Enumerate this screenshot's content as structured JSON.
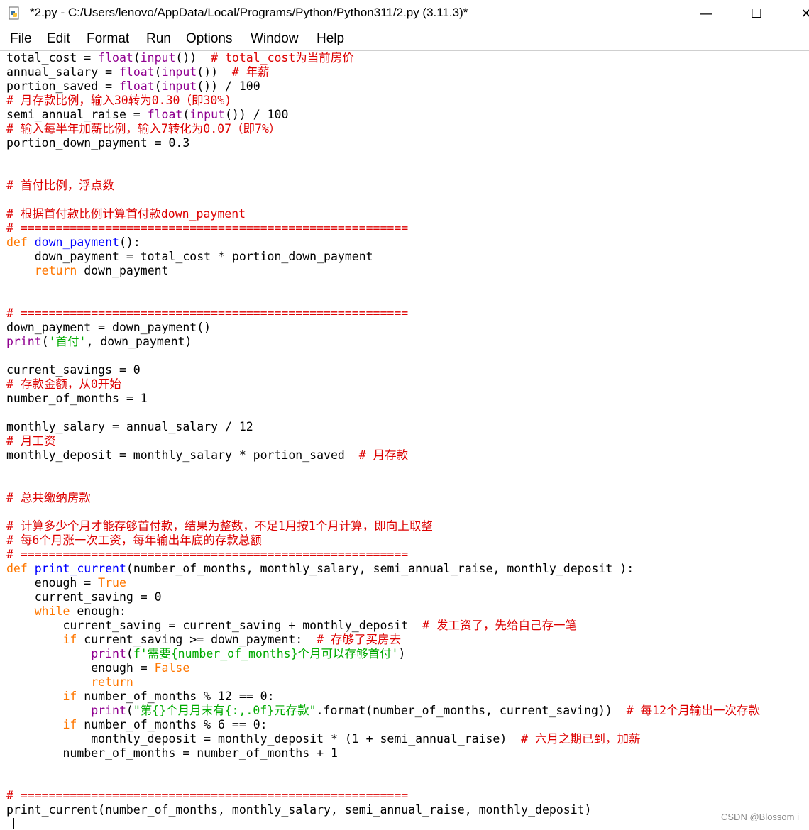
{
  "window": {
    "title": "*2.py - C:/Users/lenovo/AppData/Local/Programs/Python/Python311/2.py (3.11.3)*",
    "icon": "python-file-icon",
    "controls": {
      "minimize": "—",
      "maximize": "☐",
      "close": "✕"
    }
  },
  "menu": [
    "File",
    "Edit",
    "Format",
    "Run",
    "Options",
    "Window",
    "Help"
  ],
  "syntax_colors": {
    "comment": "#dd0000",
    "keyword": "#ff7700",
    "builtin": "#900090",
    "definition": "#0000ff",
    "string": "#00aa00"
  },
  "code_lines": [
    [
      [
        "total_cost = ",
        ""
      ],
      [
        "float",
        "bi"
      ],
      [
        "(",
        ""
      ],
      [
        "input",
        "bi"
      ],
      [
        "())  ",
        ""
      ],
      [
        "# total_cost为当前房价",
        "cm"
      ]
    ],
    [
      [
        "annual_salary = ",
        ""
      ],
      [
        "float",
        "bi"
      ],
      [
        "(",
        ""
      ],
      [
        "input",
        "bi"
      ],
      [
        "())  ",
        ""
      ],
      [
        "# 年薪",
        "cm"
      ]
    ],
    [
      [
        "portion_saved = ",
        ""
      ],
      [
        "float",
        "bi"
      ],
      [
        "(",
        ""
      ],
      [
        "input",
        "bi"
      ],
      [
        "()) / 100",
        ""
      ]
    ],
    [
      [
        "# 月存款比例，输入30转为0.30（即30%)",
        "cm"
      ]
    ],
    [
      [
        "semi_annual_raise = ",
        ""
      ],
      [
        "float",
        "bi"
      ],
      [
        "(",
        ""
      ],
      [
        "input",
        "bi"
      ],
      [
        "()) / 100",
        ""
      ]
    ],
    [
      [
        "# 输入每半年加薪比例，输入7转化为0.07（即7%）",
        "cm"
      ]
    ],
    [
      [
        "portion_down_payment = 0.3",
        ""
      ]
    ],
    [],
    [],
    [
      [
        "# 首付比例，浮点数",
        "cm"
      ]
    ],
    [],
    [
      [
        "# 根据首付款比例计算首付款down_payment",
        "cm"
      ]
    ],
    [
      [
        "# =======================================================",
        "cm"
      ]
    ],
    [
      [
        "def",
        "kw"
      ],
      [
        " ",
        ""
      ],
      [
        "down_payment",
        "df"
      ],
      [
        "():",
        ""
      ]
    ],
    [
      [
        "    down_payment = total_cost * portion_down_payment",
        ""
      ]
    ],
    [
      [
        "    ",
        ""
      ],
      [
        "return",
        "kw"
      ],
      [
        " down_payment",
        ""
      ]
    ],
    [],
    [],
    [
      [
        "# =======================================================",
        "cm"
      ]
    ],
    [
      [
        "down_payment = down_payment()",
        ""
      ]
    ],
    [
      [
        "print",
        "bi"
      ],
      [
        "(",
        ""
      ],
      [
        "'首付'",
        "st"
      ],
      [
        ", down_payment)",
        ""
      ]
    ],
    [],
    [
      [
        "current_savings = 0",
        ""
      ]
    ],
    [
      [
        "# 存款金额，从0开始",
        "cm"
      ]
    ],
    [
      [
        "number_of_months = 1",
        ""
      ]
    ],
    [],
    [
      [
        "monthly_salary = annual_salary / 12",
        ""
      ]
    ],
    [
      [
        "# 月工资",
        "cm"
      ]
    ],
    [
      [
        "monthly_deposit = monthly_salary * portion_saved  ",
        ""
      ],
      [
        "# 月存款",
        "cm"
      ]
    ],
    [],
    [],
    [
      [
        "# 总共缴纳房款",
        "cm"
      ]
    ],
    [],
    [
      [
        "# 计算多少个月才能存够首付款，结果为整数，不足1月按1个月计算，即向上取整",
        "cm"
      ]
    ],
    [
      [
        "# 每6个月涨一次工资，每年输出年底的存款总额",
        "cm"
      ]
    ],
    [
      [
        "# =======================================================",
        "cm"
      ]
    ],
    [
      [
        "def",
        "kw"
      ],
      [
        " ",
        ""
      ],
      [
        "print_current",
        "df"
      ],
      [
        "(number_of_months, monthly_salary, semi_annual_raise, monthly_deposit ):",
        ""
      ]
    ],
    [
      [
        "    enough = ",
        ""
      ],
      [
        "True",
        "kw"
      ]
    ],
    [
      [
        "    current_saving = 0",
        ""
      ]
    ],
    [
      [
        "    ",
        ""
      ],
      [
        "while",
        "kw"
      ],
      [
        " enough:",
        ""
      ]
    ],
    [
      [
        "        current_saving = current_saving + monthly_deposit  ",
        ""
      ],
      [
        "# 发工资了，先给自己存一笔",
        "cm"
      ]
    ],
    [
      [
        "        ",
        ""
      ],
      [
        "if",
        "kw"
      ],
      [
        " current_saving >= down_payment:  ",
        ""
      ],
      [
        "# 存够了买房去",
        "cm"
      ]
    ],
    [
      [
        "            ",
        ""
      ],
      [
        "print",
        "bi"
      ],
      [
        "(",
        ""
      ],
      [
        "f'需要{number_of_months}个月可以存够首付'",
        "st"
      ],
      [
        ")",
        ""
      ]
    ],
    [
      [
        "            enough = ",
        ""
      ],
      [
        "False",
        "kw"
      ]
    ],
    [
      [
        "            ",
        ""
      ],
      [
        "return",
        "kw"
      ]
    ],
    [
      [
        "        ",
        ""
      ],
      [
        "if",
        "kw"
      ],
      [
        " number_of_months % 12 == 0:",
        ""
      ]
    ],
    [
      [
        "            ",
        ""
      ],
      [
        "print",
        "bi"
      ],
      [
        "(",
        ""
      ],
      [
        "\"第{}个月月末有{:,.0f}元存款\"",
        "st"
      ],
      [
        ".format(number_of_months, current_saving))  ",
        ""
      ],
      [
        "# 每12个月输出一次存款",
        "cm"
      ]
    ],
    [
      [
        "        ",
        ""
      ],
      [
        "if",
        "kw"
      ],
      [
        " number_of_months % 6 == 0:",
        ""
      ]
    ],
    [
      [
        "            monthly_deposit = monthly_deposit * (1 + semi_annual_raise)  ",
        ""
      ],
      [
        "# 六月之期已到，加薪",
        "cm"
      ]
    ],
    [
      [
        "        number_of_months = number_of_months + 1",
        ""
      ]
    ],
    [],
    [],
    [
      [
        "# =======================================================",
        "cm"
      ]
    ],
    [
      [
        "print_current(number_of_months, monthly_salary, semi_annual_raise, monthly_deposit)",
        ""
      ]
    ]
  ],
  "watermark": "CSDN @Blossom i"
}
